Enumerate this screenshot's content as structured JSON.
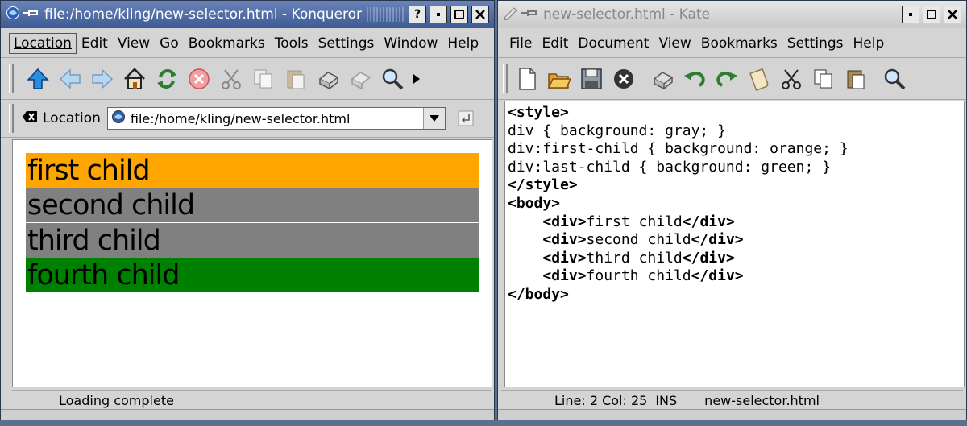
{
  "konqueror": {
    "title": "file:/home/kling/new-selector.html - Konqueror",
    "menu": [
      "Location",
      "Edit",
      "View",
      "Go",
      "Bookmarks",
      "Tools",
      "Settings",
      "Window",
      "Help"
    ],
    "location_label": "Location",
    "location_value": "file:/home/kling/new-selector.html",
    "children": [
      {
        "label": "first child",
        "color": "#ffa500"
      },
      {
        "label": "second child",
        "color": "#808080"
      },
      {
        "label": "third child",
        "color": "#808080"
      },
      {
        "label": "fourth child",
        "color": "#008000"
      }
    ],
    "status": "Loading complete"
  },
  "kate": {
    "title": "new-selector.html - Kate",
    "menu": [
      "File",
      "Edit",
      "Document",
      "View",
      "Bookmarks",
      "Settings",
      "Help"
    ],
    "code": {
      "l1": "<style>",
      "l2": "div { background: gray; }",
      "l3": "div:first-child { background: orange; }",
      "l4": "div:last-child { background: green; }",
      "l5": "</style>",
      "l6": "<body>",
      "l7_open": "<div>",
      "l7_text": "first child",
      "l7_close": "</div>",
      "l8_open": "<div>",
      "l8_text": "second child",
      "l8_close": "</div>",
      "l9_open": "<div>",
      "l9_text": "third child",
      "l9_close": "</div>",
      "l10_open": "<div>",
      "l10_text": "fourth child",
      "l10_close": "</div>",
      "l11": "</body>"
    },
    "status": {
      "linecol": "Line: 2 Col: 25",
      "mode": "INS",
      "file": "new-selector.html"
    }
  }
}
